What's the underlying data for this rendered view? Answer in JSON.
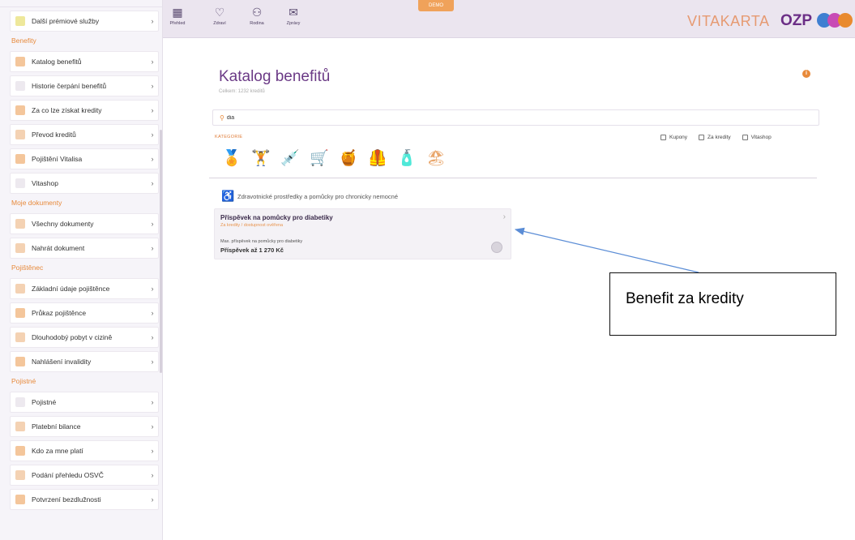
{
  "sidebar": {
    "items_top": [
      {
        "label": "Další prémiové služby",
        "color": "#e8e07a"
      }
    ],
    "sections": [
      {
        "title": "Benefity",
        "items": [
          {
            "label": "Katalog benefitů",
            "color": "#f0b37a"
          },
          {
            "label": "Historie čerpání benefitů",
            "color": "#e7e2ea"
          },
          {
            "label": "Za co lze získat kredity",
            "color": "#f0b37a"
          },
          {
            "label": "Převod kreditů",
            "color": "#f0c39a"
          },
          {
            "label": "Pojištění Vitalisa",
            "color": "#f0b37a"
          },
          {
            "label": "Vitashop",
            "color": "#e7e2ea"
          }
        ]
      },
      {
        "title": "Moje dokumenty",
        "items": [
          {
            "label": "Všechny dokumenty",
            "color": "#f0c39a"
          },
          {
            "label": "Nahrát dokument",
            "color": "#f0c39a"
          }
        ]
      },
      {
        "title": "Pojištěnec",
        "items": [
          {
            "label": "Základní údaje pojištěnce",
            "color": "#f0c39a"
          },
          {
            "label": "Průkaz pojištěnce",
            "color": "#f0b37a"
          },
          {
            "label": "Dlouhodobý pobyt v cizině",
            "color": "#f0c39a"
          },
          {
            "label": "Nahlášení invalidity",
            "color": "#f0b37a"
          }
        ]
      },
      {
        "title": "Pojistné",
        "items": [
          {
            "label": "Pojistné",
            "color": "#e7e2ea"
          },
          {
            "label": "Platební bilance",
            "color": "#f0c39a"
          },
          {
            "label": "Kdo za mne platí",
            "color": "#f0b37a"
          },
          {
            "label": "Podání přehledu OSVČ",
            "color": "#f0c39a"
          },
          {
            "label": "Potvrzení bezdlužnosti",
            "color": "#f0b37a"
          }
        ]
      }
    ]
  },
  "topbar": {
    "buttons": [
      {
        "label": "Přehled",
        "icon": "grid-icon"
      },
      {
        "label": "Zdraví",
        "icon": "heart-icon"
      },
      {
        "label": "Rodina",
        "icon": "family-icon"
      },
      {
        "label": "Zprávy",
        "icon": "mail-icon"
      }
    ],
    "demo_badge": "DEMO",
    "brand_text": "VITAKARTA",
    "brand_ozp": "OZP"
  },
  "main": {
    "title": "Katalog benefitů",
    "subtitle": "Celkem: 1232 kreditů",
    "search_value": "dia",
    "categories_label": "KATEGORIE",
    "filters": [
      "Kupony",
      "Za kredity",
      "Vitashop"
    ],
    "category_icons": [
      "🏅",
      "🏋",
      "💉",
      "🛒",
      "🍯",
      "🦺",
      "🧴",
      "🏖"
    ],
    "group_title": "Zdravotnické prostředky a pomůcky pro chronicky nemocné",
    "card": {
      "title": "Příspěvek na pomůcky pro diabetiky",
      "subtitle": "Za kredity / dostupnost ověřena",
      "description": "Max. příspěvek na pomůcky pro diabetiky",
      "amount": "Příspěvek až 1 270 Kč"
    }
  },
  "annotation": {
    "text": "Benefit za kredity"
  },
  "colors": {
    "accent_orange": "#e8893a",
    "brand_purple": "#6b2e86",
    "sidebar_bg": "#f6f4f9",
    "topbar_bg": "#ebe5ef",
    "arrow_blue": "#5b8dd6"
  }
}
